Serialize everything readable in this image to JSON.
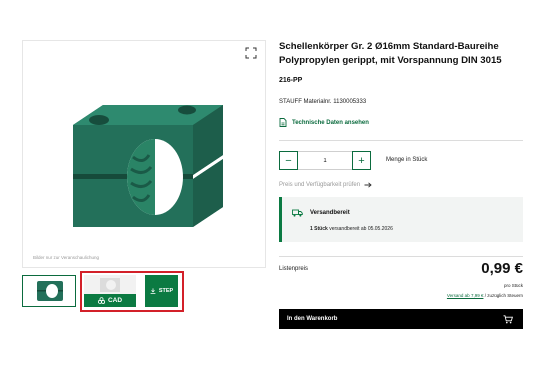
{
  "gallery": {
    "caption": "Bilder nur zur Veranschaulichung",
    "thumb_cad_label": "CAD",
    "thumb_step_label": "STEP"
  },
  "product": {
    "title_line1": "Schellenkörper Gr. 2 Ø16mm Standard-Baureihe",
    "title_line2": "Polypropylen gerippt, mit Vorspannung DIN 3015",
    "sku": "216-PP",
    "material_number": "STAUFF Materialnr. 1130005333",
    "tech_data_link": "Technische Daten ansehen"
  },
  "quantity": {
    "value": "1",
    "decrement": "−",
    "increment": "+",
    "unit_label": "Menge in Stück"
  },
  "price_check_link": "Preis und Verfügbarkeit prüfen",
  "availability": {
    "status": "Versandbereit",
    "qty_bold": "1 Stück",
    "detail": "versandbereit ab 05.05.2026"
  },
  "pricing": {
    "list_label": "Listenpreis",
    "price": "0,99 €",
    "per_unit": "pro Stück",
    "shipping_link": "Versand ab 7,99 €",
    "shipping_suffix": "/ zuzüglich Steuern"
  },
  "cart": {
    "label": "In den Warenkorb"
  },
  "colors": {
    "brand_green": "#0b7a42",
    "product_green": "#1f6b54",
    "highlight_red": "#d32029"
  },
  "icons": [
    "expand-icon",
    "document-icon",
    "arrow-right-icon",
    "truck-icon",
    "cart-icon",
    "cad-icon",
    "download-icon"
  ]
}
